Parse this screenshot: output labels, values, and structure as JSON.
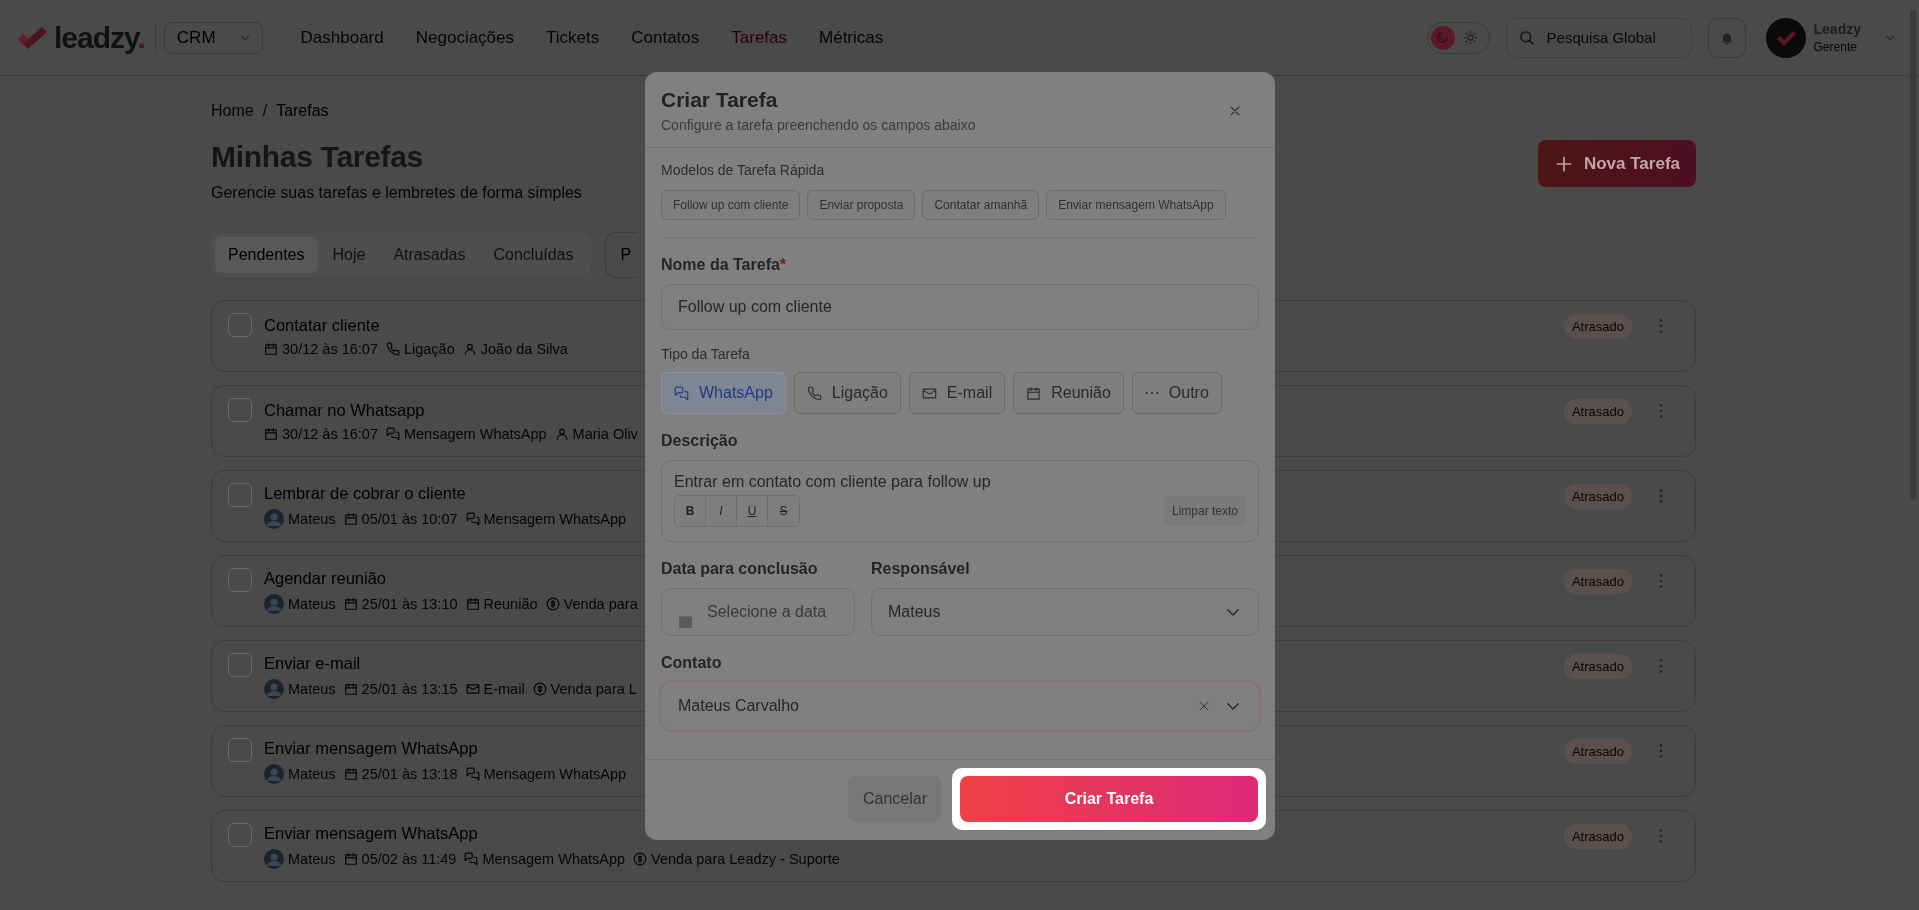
{
  "header": {
    "logo": {
      "text": "leadzy",
      "dot": "."
    },
    "module_select": {
      "value": "CRM"
    },
    "nav": [
      {
        "label": "Dashboard",
        "selected": false
      },
      {
        "label": "Negociações",
        "selected": false
      },
      {
        "label": "Tickets",
        "selected": false
      },
      {
        "label": "Contatos",
        "selected": false
      },
      {
        "label": "Tarefas",
        "selected": true
      },
      {
        "label": "Métricas",
        "selected": false
      }
    ],
    "theme": {
      "dark": true
    },
    "search": {
      "placeholder": "Pesquisa Global"
    },
    "user": {
      "name": "Leadzy",
      "role": "Gerente"
    }
  },
  "breadcrumb": {
    "items": [
      "Home",
      "Tarefas"
    ],
    "separator": "/"
  },
  "page": {
    "title": "Minhas Tarefas",
    "subtitle": "Gerencie suas tarefas e lembretes de forma simples",
    "new_button": "Nova Tarefa"
  },
  "tabs": [
    {
      "label": "Pendentes",
      "selected": true
    },
    {
      "label": "Hoje",
      "selected": false
    },
    {
      "label": "Atrasadas",
      "selected": false
    },
    {
      "label": "Concluídas",
      "selected": false
    }
  ],
  "filter": {
    "label": "P"
  },
  "tasks": [
    {
      "title": "Contatar cliente",
      "checked": false,
      "status": "Atrasado",
      "meta": [
        {
          "kind": "date",
          "text": "30/12 às 16:07"
        },
        {
          "kind": "call",
          "text": "Ligação"
        },
        {
          "kind": "contact",
          "text": "João da Silva"
        }
      ]
    },
    {
      "title": "Chamar no Whatsapp",
      "checked": false,
      "status": "Atrasado",
      "meta": [
        {
          "kind": "date",
          "text": "30/12 às 16:07"
        },
        {
          "kind": "whatsapp",
          "text": "Mensagem WhatsApp"
        },
        {
          "kind": "contact",
          "text": "Maria Oliv"
        }
      ]
    },
    {
      "title": "Lembrar de cobrar o cliente",
      "checked": false,
      "status": "Atrasado",
      "meta": [
        {
          "kind": "avatar",
          "text": "Mateus"
        },
        {
          "kind": "date",
          "text": "05/01 às 10:07"
        },
        {
          "kind": "whatsapp",
          "text": "Mensagem WhatsApp"
        }
      ]
    },
    {
      "title": "Agendar reunião",
      "checked": false,
      "status": "Atrasado",
      "meta": [
        {
          "kind": "avatar",
          "text": "Mateus"
        },
        {
          "kind": "date",
          "text": "25/01 às 13:10"
        },
        {
          "kind": "meeting",
          "text": "Reunião"
        },
        {
          "kind": "deal",
          "text": "Venda para"
        }
      ]
    },
    {
      "title": "Enviar e-mail",
      "checked": false,
      "status": "Atrasado",
      "meta": [
        {
          "kind": "avatar",
          "text": "Mateus"
        },
        {
          "kind": "date",
          "text": "25/01 às 13:15"
        },
        {
          "kind": "email",
          "text": "E-mail"
        },
        {
          "kind": "deal",
          "text": "Venda para L"
        }
      ]
    },
    {
      "title": "Enviar mensagem WhatsApp",
      "checked": false,
      "status": "Atrasado",
      "meta": [
        {
          "kind": "avatar",
          "text": "Mateus"
        },
        {
          "kind": "date",
          "text": "25/01 às 13:18"
        },
        {
          "kind": "whatsapp",
          "text": "Mensagem WhatsApp"
        }
      ]
    },
    {
      "title": "Enviar mensagem WhatsApp",
      "checked": false,
      "status": "Atrasado",
      "meta": [
        {
          "kind": "avatar",
          "text": "Mateus"
        },
        {
          "kind": "date",
          "text": "05/02 às 11:49"
        },
        {
          "kind": "whatsapp",
          "text": "Mensagem WhatsApp"
        },
        {
          "kind": "deal",
          "text": "Venda para Leadzy - Suporte"
        }
      ]
    }
  ],
  "modal": {
    "title": "Criar Tarefa",
    "subtitle": "Configure a tarefa preenchendo os campos abaixo",
    "templates_label": "Modelos de Tarefa Rápida",
    "templates": [
      "Follow up com cliente",
      "Enviar proposta",
      "Contatar amanhã",
      "Enviar mensagem WhatsApp"
    ],
    "name_label": "Nome da Tarefa",
    "required_mark": "*",
    "name_value": "Follow up com cliente",
    "type_label": "Tipo da Tarefa",
    "types": [
      {
        "kind": "whatsapp",
        "label": "WhatsApp",
        "selected": true
      },
      {
        "kind": "call",
        "label": "Ligação",
        "selected": false
      },
      {
        "kind": "email",
        "label": "E-mail",
        "selected": false
      },
      {
        "kind": "meeting",
        "label": "Reunião",
        "selected": false
      },
      {
        "kind": "other",
        "label": "Outro",
        "selected": false
      }
    ],
    "description_label": "Descrição",
    "description_value": "Entrar em contato com cliente para follow up",
    "format_buttons": [
      {
        "kind": "bold",
        "label": "B"
      },
      {
        "kind": "italic",
        "label": "I"
      },
      {
        "kind": "underline",
        "label": "U"
      },
      {
        "kind": "strike",
        "label": "S"
      }
    ],
    "clear_button": "Limpar texto",
    "date_label": "Data para conclusão",
    "date_placeholder": "Selecione a data",
    "owner_label": "Responsável",
    "owner_value": "Mateus",
    "contact_label": "Contato",
    "contact_value": "Mateus Carvalho",
    "cancel": "Cancelar",
    "submit": "Criar Tarefa",
    "submit_highlighted": true
  }
}
